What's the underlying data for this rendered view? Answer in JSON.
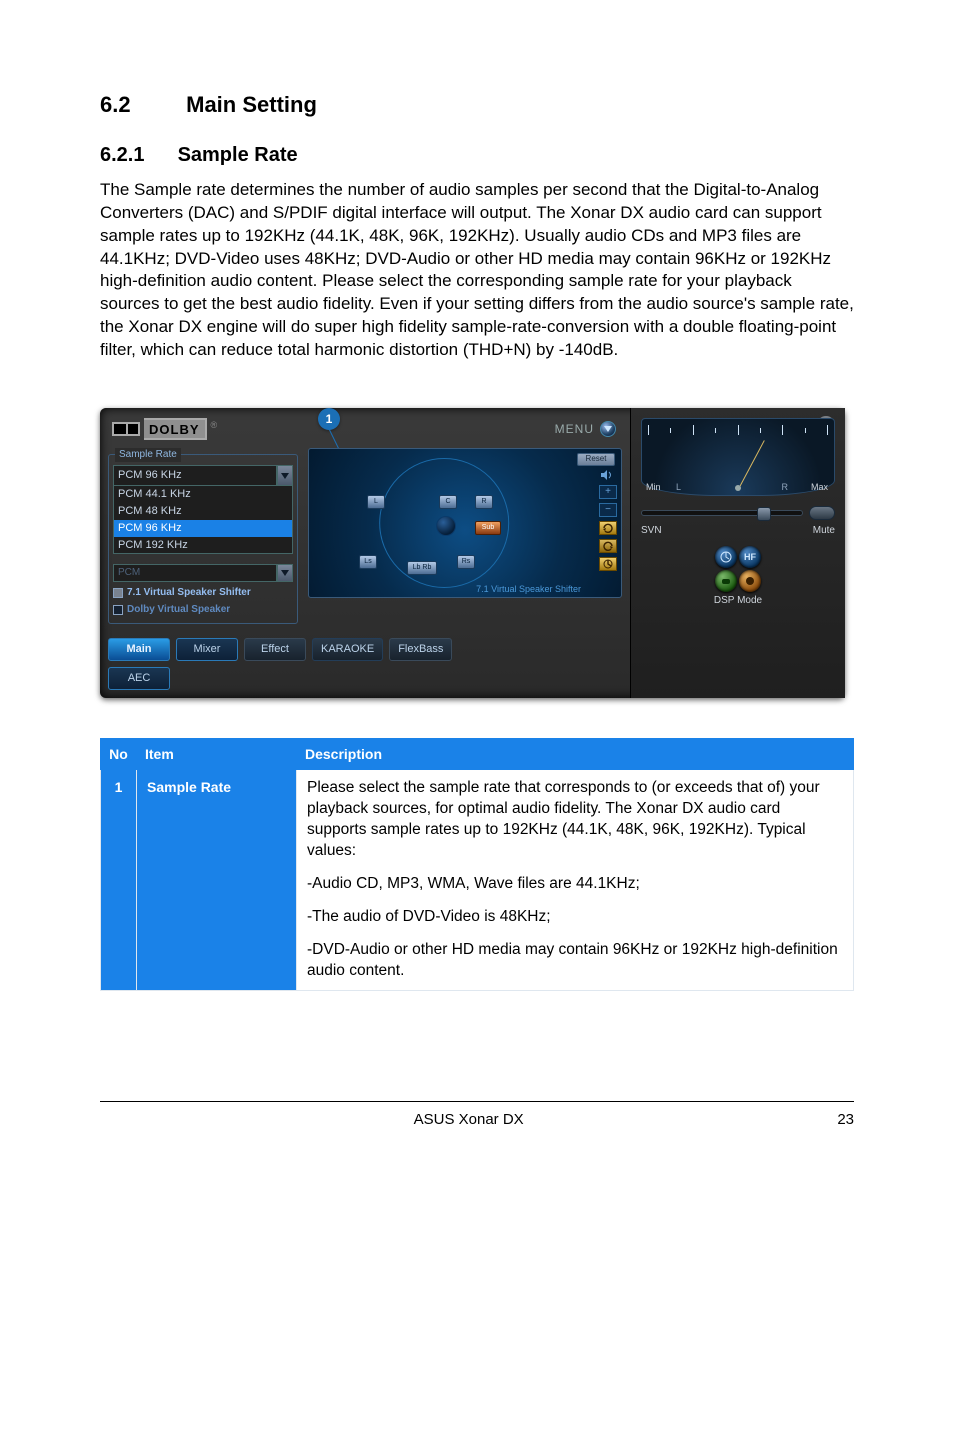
{
  "heading": {
    "number": "6.2",
    "title": "Main Setting"
  },
  "subheading": {
    "number": "6.2.1",
    "title": "Sample Rate"
  },
  "paragraph": "The Sample rate determines the number of audio samples per second that the Digital-to-Analog Converters (DAC) and S/PDIF digital interface will output. The Xonar DX audio card can support sample rates up to 192KHz (44.1K, 48K, 96K, 192KHz). Usually audio CDs and MP3 files are 44.1KHz; DVD-Video uses 48KHz; DVD-Audio or other HD media may contain 96KHz or 192KHz high-definition audio content. Please select the corresponding sample rate for your playback sources to get the best audio fidelity. Even if your setting differs from the audio source's sample rate, the Xonar DX engine will do super high fidelity sample-rate-conversion with a double floating-point filter, which can reduce total harmonic distortion (THD+N) by -140dB.",
  "callout_badge": "1",
  "app": {
    "logo_word": "DOLBY",
    "logo_reg": "®",
    "menu_label": "MENU",
    "sample_rate_group": "Sample Rate",
    "sample_rate_selected": "PCM 96 KHz",
    "sample_rate_options": [
      "PCM 44.1 KHz",
      "PCM 48 KHz",
      "PCM 96 KHz",
      "PCM 192 KHz"
    ],
    "sub_select": "PCM",
    "chk_vss": "7.1 Virtual Speaker Shifter",
    "chk_dvs": "Dolby Virtual Speaker",
    "stage_reset": "Reset",
    "stage_caption": "7.1 Virtual Speaker Shifter",
    "spk_sub": "Sub",
    "side_plus": "+",
    "side_minus": "−",
    "tabs": {
      "main": "Main",
      "mixer": "Mixer",
      "effect": "Effect",
      "karaoke": "KARAOKE",
      "flexbass": "FlexBass",
      "aec": "AEC"
    },
    "right": {
      "min": "Min",
      "max": "Max",
      "l": "L",
      "r": "R",
      "svn": "SVN",
      "mute": "Mute",
      "hf": "HF",
      "dsp": "DSP Mode"
    }
  },
  "table": {
    "headers": {
      "no": "No",
      "item": "Item",
      "desc": "Description"
    },
    "row": {
      "no": "1",
      "item": "Sample Rate",
      "p1": "Please select the sample rate that corresponds to (or exceeds that of) your playback sources, for optimal audio fidelity. The Xonar DX audio card supports sample rates up to 192KHz (44.1K, 48K, 96K, 192KHz). Typical values:",
      "p2": "-Audio CD, MP3, WMA, Wave files are 44.1KHz;",
      "p3": "-The audio of DVD-Video is 48KHz;",
      "p4": "-DVD-Audio or other HD media may contain 96KHz or 192KHz high-definition audio content."
    }
  },
  "footer": {
    "product": "ASUS Xonar DX",
    "page": "23"
  }
}
